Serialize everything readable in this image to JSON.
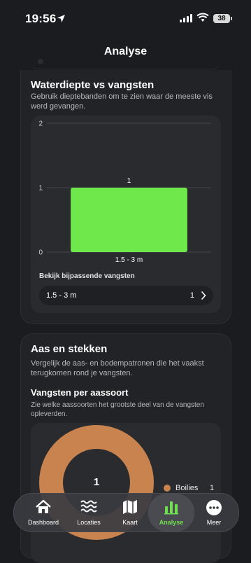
{
  "status": {
    "time": "19:56",
    "battery": "38"
  },
  "page": {
    "title": "Analyse"
  },
  "depth": {
    "title": "Waterdiepte vs vangsten",
    "subtitle": "Gebruik dieptebanden om te zien waar de meeste vis werd gevangen.",
    "match_label": "Bekijk bijpassende vangsten",
    "match_row": {
      "range": "1.5 - 3 m",
      "count": "1"
    }
  },
  "bait": {
    "title": "Aas en stekken",
    "subtitle": "Vergelijk de aas- en bodempatronen die het vaakst terugkomen rond je vangsten.",
    "per_bait_title": "Vangsten per aassoort",
    "per_bait_subtitle": "Zie welke aassoorten het grootste deel van de vangsten opleverden."
  },
  "chart_data": [
    {
      "type": "bar",
      "categories": [
        "1.5 - 3 m"
      ],
      "values": [
        1
      ],
      "data_labels": [
        "1"
      ],
      "yticks": [
        "0",
        "1",
        "2"
      ],
      "ylim": [
        0,
        2
      ],
      "grid": true,
      "color": "#6ee84a"
    },
    {
      "type": "pie",
      "categories": [
        "Boilies"
      ],
      "values": [
        1
      ],
      "center_label": "1",
      "colors": [
        "#c8834e"
      ],
      "legend": "right"
    }
  ],
  "tabs": [
    {
      "label": "Dashboard",
      "icon": "home-icon",
      "active": false
    },
    {
      "label": "Locaties",
      "icon": "waves-icon",
      "active": false
    },
    {
      "label": "Kaart",
      "icon": "map-icon",
      "active": false
    },
    {
      "label": "Analyse",
      "icon": "bar-chart-icon",
      "active": true
    },
    {
      "label": "Meer",
      "icon": "more-icon",
      "active": false
    }
  ],
  "colors": {
    "accent": "#6fe04d",
    "bait": "#c8834e",
    "background": "#1b1c1f"
  }
}
